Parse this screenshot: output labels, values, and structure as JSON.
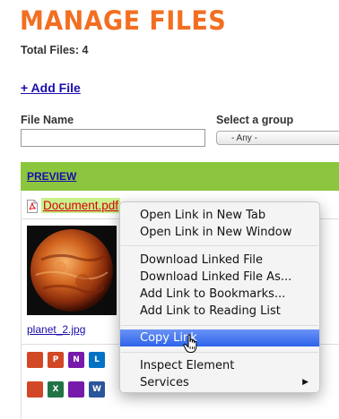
{
  "header": {
    "title": "MANAGE FILES",
    "total_files": "Total Files: 4"
  },
  "actions": {
    "add_file": "+ Add File"
  },
  "filters": {
    "file_name_label": "File Name",
    "file_name_value": "",
    "group_label": "Select a group",
    "group_selected": "- Any -"
  },
  "table": {
    "preview_header": "PREVIEW",
    "rows": [
      {
        "file": "Document.pdf"
      },
      {
        "file": "planet_2.jpg"
      }
    ]
  },
  "context_menu": {
    "items": [
      {
        "label": "Open Link in New Tab"
      },
      {
        "label": "Open Link in New Window"
      },
      {
        "label": "Download Linked File"
      },
      {
        "label": "Download Linked File As..."
      },
      {
        "label": "Add Link to Bookmarks..."
      },
      {
        "label": "Add Link to Reading List"
      },
      {
        "label": "Copy Link",
        "highlighted": true
      },
      {
        "label": "Inspect Element"
      },
      {
        "label": "Services",
        "submenu": true
      }
    ]
  },
  "office_icons": [
    {
      "letter": "",
      "color": "#d24726"
    },
    {
      "letter": "P",
      "color": "#d24726"
    },
    {
      "letter": "N",
      "color": "#7719aa"
    },
    {
      "letter": "L",
      "color": "#0072c6"
    },
    {
      "letter": "",
      "color": "#d24726"
    },
    {
      "letter": "X",
      "color": "#217346"
    },
    {
      "letter": "",
      "color": "#7719aa"
    },
    {
      "letter": "W",
      "color": "#2b579a"
    }
  ],
  "colors": {
    "title": "#f26f21",
    "preview_bar": "#8cc63f",
    "link": "#1a0dab",
    "doc_link": "#d8000c",
    "menu_highlight": "#3a6ee8"
  }
}
